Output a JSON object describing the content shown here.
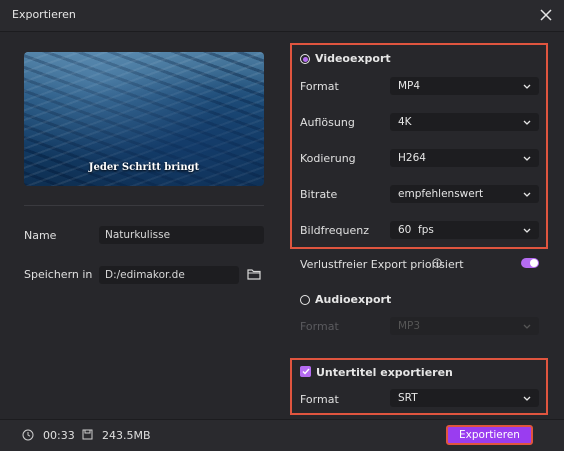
{
  "window": {
    "title": "Exportieren"
  },
  "preview": {
    "caption": "Jeder Schritt bringt"
  },
  "left": {
    "name_label": "Name",
    "name_value": "Naturkulisse",
    "save_label": "Speichern in",
    "save_value": "D:/edimakor.de"
  },
  "video": {
    "title": "Videoexport",
    "selected": true,
    "rows": [
      {
        "label": "Format",
        "value": "MP4"
      },
      {
        "label": "Auflösung",
        "value": "4K"
      },
      {
        "label": "Kodierung",
        "value": "H264"
      },
      {
        "label": "Bitrate",
        "value": "empfehlenswert"
      },
      {
        "label": "Bildfrequenz",
        "value": "60  fps"
      }
    ]
  },
  "lossless": {
    "label": "Verlustfreier Export priorisiert",
    "enabled": true
  },
  "audio": {
    "title": "Audioexport",
    "selected": false,
    "format_label": "Format",
    "format_value": "MP3"
  },
  "subtitle": {
    "title": "Untertitel exportieren",
    "checked": true,
    "format_label": "Format",
    "format_value": "SRT"
  },
  "footer": {
    "duration": "00:33",
    "size": "243.5MB",
    "export_label": "Exportieren"
  },
  "colors": {
    "accent": "#b56cf2",
    "highlight": "#e0553f",
    "button": "#9a3df0"
  }
}
